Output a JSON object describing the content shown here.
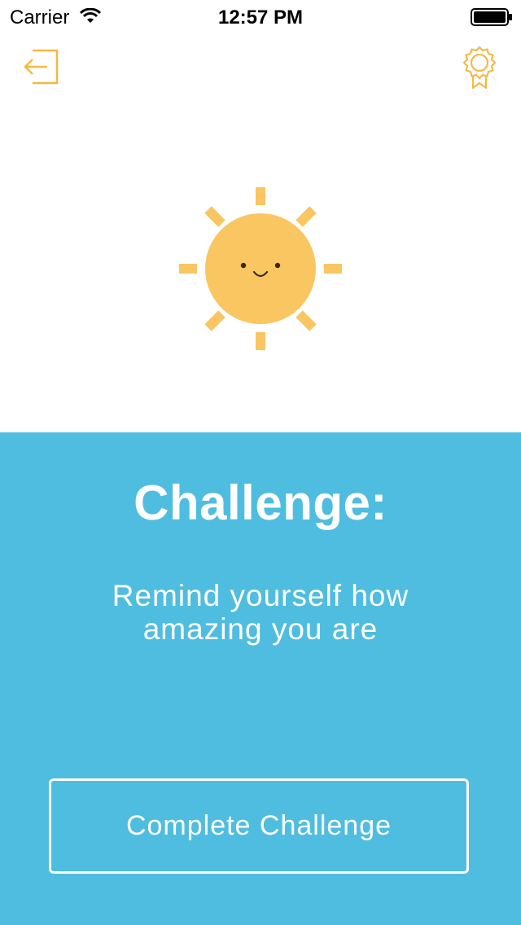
{
  "status_bar": {
    "carrier": "Carrier",
    "time": "12:57 PM"
  },
  "nav": {
    "left_icon": "logout-icon",
    "right_icon": "award-icon"
  },
  "illustration": {
    "icon": "smiling-sun-icon",
    "color": "#F9C662"
  },
  "challenge": {
    "heading": "Challenge:",
    "text": "Remind yourself how amazing you are",
    "button_label": "Complete Challenge"
  },
  "colors": {
    "accent": "#F5B942",
    "panel": "#4FBDE0",
    "sun": "#F9C662"
  }
}
